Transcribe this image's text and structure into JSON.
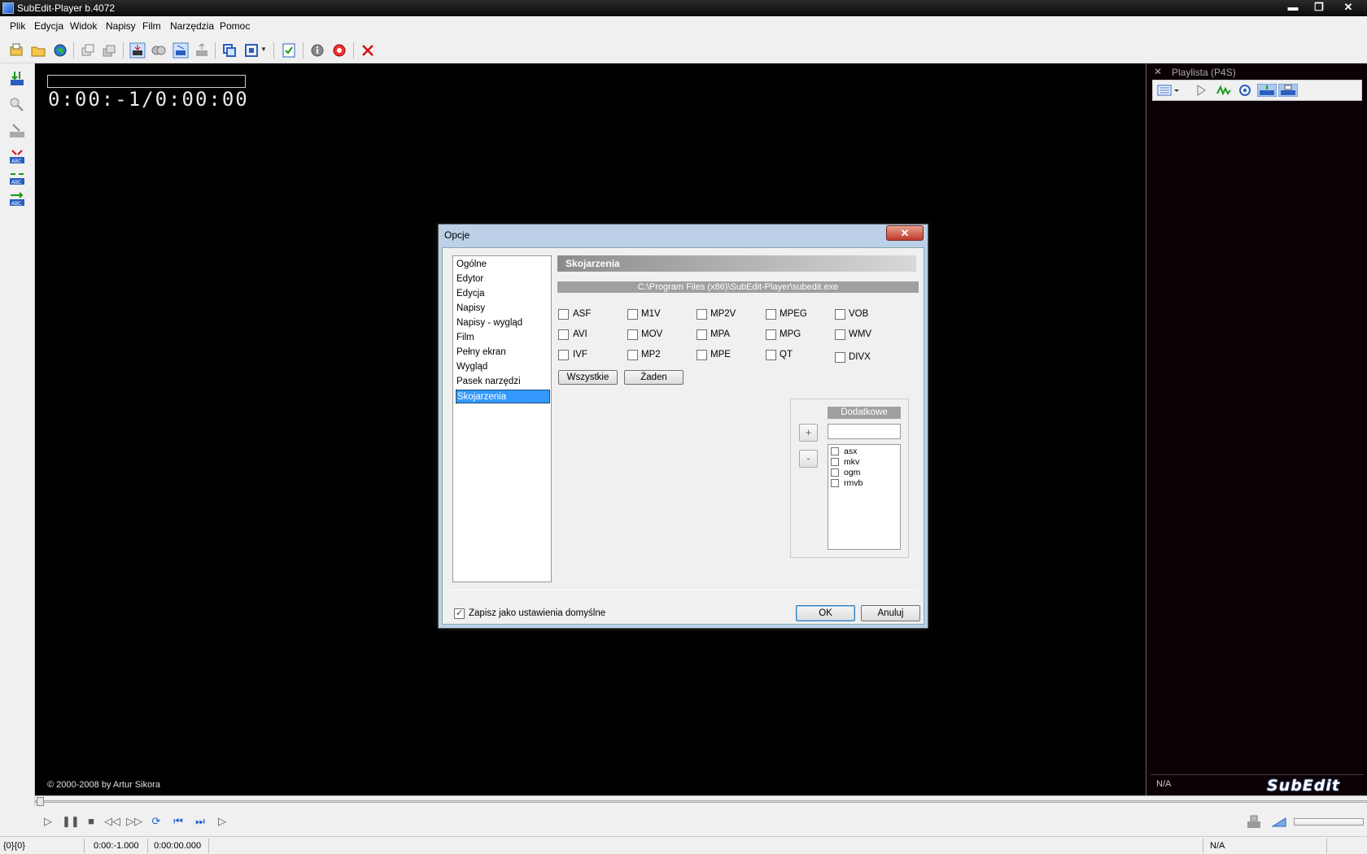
{
  "window": {
    "title": "SubEdit-Player  b.4072",
    "minimize": "▬",
    "maximize": "❐",
    "close": "✕"
  },
  "menu": [
    "Plik",
    "Edycja",
    "Widok",
    "Napisy",
    "Film",
    "Narzędzia",
    "Pomoc"
  ],
  "video": {
    "timecode": "0:00:-1/0:00:00",
    "copyright": "© 2000-2008 by Artur Sikora"
  },
  "playlist": {
    "title": "Playlista (P4S)",
    "close": "✕",
    "status": "N/A",
    "logo": "SubEdit"
  },
  "statusbar": {
    "cell1": "{0}{0}",
    "cell2": "0:00:-1.000",
    "cell3": "0:00:00.000",
    "cell4": "N/A"
  },
  "dialog": {
    "title": "Opcje",
    "close": "✕",
    "categories": [
      "Ogólne",
      "Edytor",
      "Edycja",
      "Napisy",
      "Napisy - wygląd",
      "Film",
      "Pełny ekran",
      "Wygląd",
      "Pasek narzędzi",
      "Skojarzenia"
    ],
    "selected_category": "Skojarzenia",
    "section_title": "Skojarzenia",
    "exe_path": "C:\\Program Files (x86)\\SubEdit-Player\\subedit.exe",
    "formats": [
      [
        "ASF",
        "M1V",
        "MP2V",
        "MPEG",
        "VOB"
      ],
      [
        "AVI",
        "MOV",
        "MPA",
        "MPG",
        "WMV"
      ],
      [
        "IVF",
        "MP2",
        "MPE",
        "QT",
        "DIVX"
      ]
    ],
    "btn_all": "Wszystkie",
    "btn_none": "Żaden",
    "extra_title": "Dodatkowe",
    "extra_input_value": "",
    "btn_plus": "+",
    "btn_minus": "-",
    "extras": [
      "asx",
      "mkv",
      "ogm",
      "rmvb"
    ],
    "save_default_label": "Zapisz jako ustawienia domyślne",
    "save_default_checked": true,
    "ok": "OK",
    "cancel": "Anuluj"
  },
  "colors": {
    "selection": "#3399ff",
    "dialog_frame": "#bcd0e8",
    "video_bg": "#000000",
    "playlist_bg": "#0a0006"
  }
}
